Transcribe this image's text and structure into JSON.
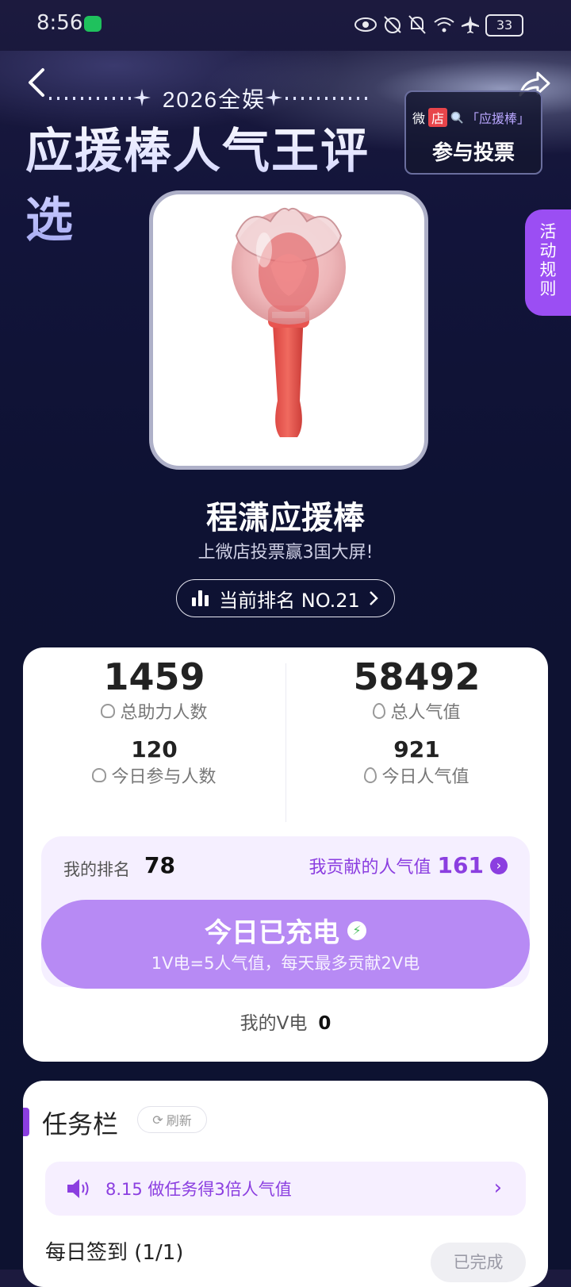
{
  "status_bar": {
    "time": "8:56",
    "battery": "33"
  },
  "banner": {
    "year_label": "2026全娱",
    "title": "应援棒人气王评选",
    "vote_box": {
      "shop_tag_1": "微",
      "shop_tag_2": "店",
      "keyword": "「应援棒」",
      "cta": "参与投票"
    }
  },
  "rules_tab": {
    "label": "活动规则"
  },
  "product": {
    "name": "程潇应援棒",
    "subtitle": "上微店投票赢3国大屏!"
  },
  "rank_pill": {
    "label": "当前排名 NO.21"
  },
  "stats": {
    "total_helpers": {
      "value": "1459",
      "label": "总助力人数"
    },
    "total_popularity": {
      "value": "58492",
      "label": "总人气值"
    },
    "today_participants": {
      "value": "120",
      "label": "今日参与人数"
    },
    "today_popularity": {
      "value": "921",
      "label": "今日人气值"
    }
  },
  "mine": {
    "rank_label": "我的排名",
    "rank_value": "78",
    "contrib_label": "我贡献的人气值",
    "contrib_value": "161",
    "charge_title": "今日已充电",
    "charge_sub": "1V电=5人气值，每天最多贡献2V电",
    "v_label": "我的V电",
    "v_value": "0"
  },
  "tasks": {
    "title": "任务栏",
    "refresh": "刷新",
    "notice": "8.15 做任务得3倍人气值",
    "daily_label": "每日签到 (1/1)",
    "daily_status": "已完成"
  },
  "colors": {
    "accent": "#8b3ee0",
    "charge_button": "#b78af4",
    "rules_tab": "#9b4ef3"
  }
}
